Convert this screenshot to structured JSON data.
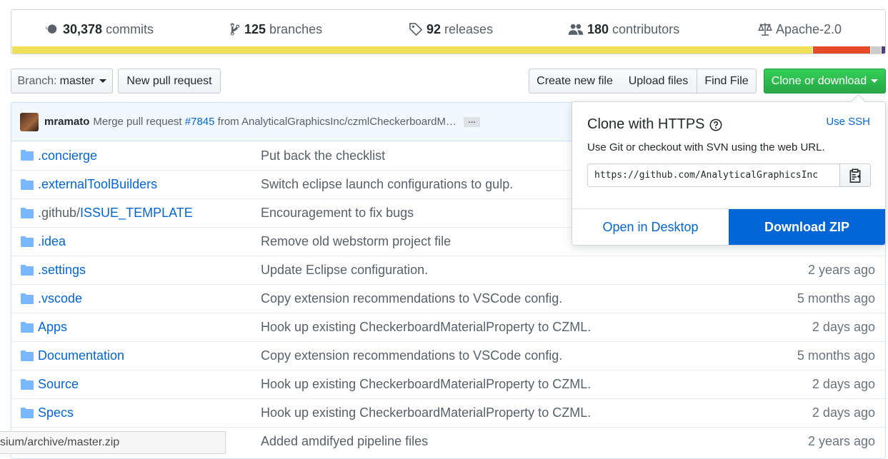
{
  "summary": {
    "commits": {
      "count": "30,378",
      "label": "commits",
      "icon": "history-icon"
    },
    "branches": {
      "count": "125",
      "label": "branches",
      "icon": "git-branch-icon"
    },
    "releases": {
      "count": "92",
      "label": "releases",
      "icon": "tag-icon"
    },
    "contributors": {
      "count": "180",
      "label": "contributors",
      "icon": "people-icon"
    },
    "license": {
      "label": "Apache-2.0",
      "icon": "law-icon"
    }
  },
  "languages": [
    {
      "fraction": 0.919,
      "color": "#f1e05a"
    },
    {
      "fraction": 0.065,
      "color": "#e34c26"
    },
    {
      "fraction": 0.012,
      "color": "#cccccc"
    },
    {
      "fraction": 0.004,
      "color": "#563d7c"
    }
  ],
  "toolbar": {
    "branch_prefix": "Branch:",
    "branch_name": "master",
    "new_pull_request": "New pull request",
    "create_new_file": "Create new file",
    "upload_files": "Upload files",
    "find_file": "Find File",
    "clone_or_download": "Clone or download"
  },
  "commit": {
    "author": "mramato",
    "message_prefix": "Merge pull request",
    "pr_link": "#7845",
    "message_suffix": "from AnalyticalGraphicsInc/czmlCheckerboardM…",
    "ellipsis": "…"
  },
  "files": [
    {
      "dir": "",
      "name": ".concierge",
      "message": "Put back the checklist",
      "age": ""
    },
    {
      "dir": "",
      "name": ".externalToolBuilders",
      "message": "Switch eclipse launch configurations to gulp.",
      "age": ""
    },
    {
      "dir": ".github/",
      "name": "ISSUE_TEMPLATE",
      "message": "Encouragement to fix bugs",
      "age": ""
    },
    {
      "dir": "",
      "name": ".idea",
      "message": "Remove old webstorm project file",
      "age": ""
    },
    {
      "dir": "",
      "name": ".settings",
      "message": "Update Eclipse configuration.",
      "age": "2 years ago"
    },
    {
      "dir": "",
      "name": ".vscode",
      "message": "Copy extension recommendations to VSCode config.",
      "age": "5 months ago"
    },
    {
      "dir": "",
      "name": "Apps",
      "message": "Hook up existing CheckerboardMaterialProperty to CZML.",
      "age": "2 days ago"
    },
    {
      "dir": "",
      "name": "Documentation",
      "message": "Copy extension recommendations to VSCode config.",
      "age": "5 months ago"
    },
    {
      "dir": "",
      "name": "Source",
      "message": "Hook up existing CheckerboardMaterialProperty to CZML.",
      "age": "2 days ago"
    },
    {
      "dir": "",
      "name": "Specs",
      "message": "Hook up existing CheckerboardMaterialProperty to CZML.",
      "age": "2 days ago"
    },
    {
      "dir": "",
      "name": "",
      "message": "Added amdifyed pipeline files",
      "age": "2 years ago"
    }
  ],
  "status_bar": {
    "text": "sium/archive/master.zip"
  },
  "clone_dropdown": {
    "title": "Clone with HTTPS",
    "use_ssh": "Use SSH",
    "description": "Use Git or checkout with SVN using the web URL.",
    "url": "https://github.com/AnalyticalGraphicsInc",
    "open_in_desktop": "Open in Desktop",
    "download_zip": "Download ZIP"
  },
  "colors": {
    "link": "#0366d6",
    "green_button": "#28a745",
    "download_button": "#0366d6"
  }
}
